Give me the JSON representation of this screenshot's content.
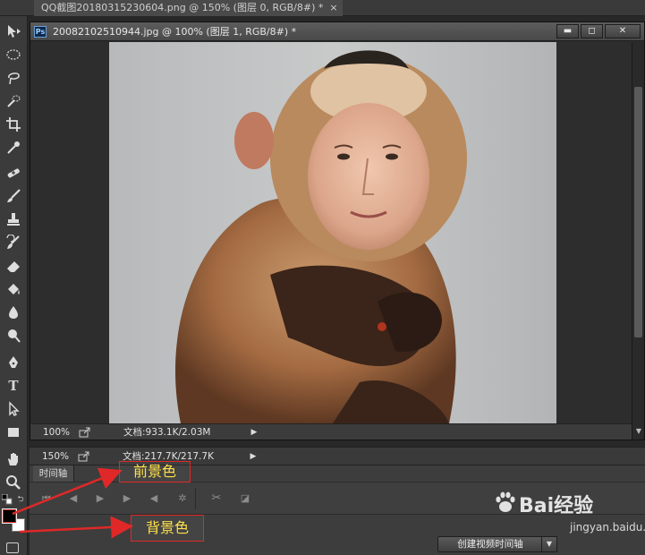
{
  "top_tab": {
    "title": "QQ截图20180315230604.png @ 150% (图层 0, RGB/8#) *",
    "close": "×"
  },
  "doc_window": {
    "title": "20082102510944.jpg @ 100% (图层 1, RGB/8#) *",
    "app_icon": "Ps",
    "buttons": {
      "minimize": "▬",
      "maximize": "◻",
      "close": "✕"
    },
    "status": {
      "zoom": "100%",
      "doc_size": "文档:933.1K/2.03M",
      "arrow": "▶"
    }
  },
  "background_doc_status": {
    "zoom": "150%",
    "doc_size": "文档:217.7K/217.7K",
    "arrow": "▶"
  },
  "timeline": {
    "tab": "时间轴",
    "controls": [
      "skip-to-start-icon",
      "prev-frame-icon",
      "play-icon",
      "next-frame-icon",
      "volume-icon",
      "settings-icon",
      "scissors-icon",
      "transition-icon"
    ],
    "create_button": "创建视频时间轴",
    "create_dropdown": "▼"
  },
  "tools": [
    "move-tool-icon",
    "marquee-tool-icon",
    "lasso-tool-icon",
    "quick-select-tool-icon",
    "crop-tool-icon",
    "eyedropper-tool-icon",
    "healing-brush-tool-icon",
    "brush-tool-icon",
    "clone-stamp-tool-icon",
    "history-brush-tool-icon",
    "eraser-tool-icon",
    "paint-bucket-tool-icon",
    "blur-tool-icon",
    "dodge-tool-icon",
    "pen-tool-icon",
    "type-tool-icon",
    "path-select-tool-icon",
    "rectangle-tool-icon",
    "hand-tool-icon",
    "zoom-tool-icon"
  ],
  "colors": {
    "foreground": "#000000",
    "background": "#ffffff",
    "annotation_red": "#e02828",
    "annotation_text": "#ffe14a"
  },
  "annotations": {
    "foreground_label": "前景色",
    "background_label": "背景色"
  },
  "watermark": {
    "brand": "Bai",
    "brand_suffix": "经验",
    "domain": "jingyan.baidu.com"
  }
}
